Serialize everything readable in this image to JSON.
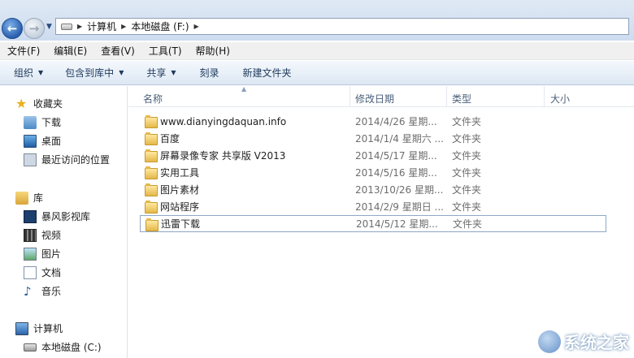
{
  "address": {
    "crumbs": [
      "计算机",
      "本地磁盘 (F:)"
    ]
  },
  "menubar": {
    "items": [
      "文件(F)",
      "编辑(E)",
      "查看(V)",
      "工具(T)",
      "帮助(H)"
    ]
  },
  "commandbar": {
    "items": [
      "组织",
      "包含到库中",
      "共享",
      "刻录",
      "新建文件夹"
    ]
  },
  "navpane": {
    "favorites": {
      "label": "收藏夹",
      "items": [
        "下载",
        "桌面",
        "最近访问的位置"
      ]
    },
    "libraries": {
      "label": "库",
      "items": [
        "暴风影视库",
        "视频",
        "图片",
        "文档",
        "音乐"
      ]
    },
    "computer": {
      "label": "计算机",
      "items": [
        "本地磁盘 (C:)"
      ]
    }
  },
  "columns": {
    "name": "名称",
    "date": "修改日期",
    "type": "类型",
    "size": "大小"
  },
  "files": [
    {
      "name": "www.dianyingdaquan.info",
      "date": "2014/4/26 星期...",
      "type": "文件夹"
    },
    {
      "name": "百度",
      "date": "2014/1/4 星期六 ...",
      "type": "文件夹"
    },
    {
      "name": "屏幕录像专家 共享版 V2013",
      "date": "2014/5/17 星期...",
      "type": "文件夹"
    },
    {
      "name": "实用工具",
      "date": "2014/5/16 星期...",
      "type": "文件夹"
    },
    {
      "name": "图片素材",
      "date": "2013/10/26 星期...",
      "type": "文件夹"
    },
    {
      "name": "网站程序",
      "date": "2014/2/9 星期日 ...",
      "type": "文件夹"
    },
    {
      "name": "迅雷下载",
      "date": "2014/5/12 星期...",
      "type": "文件夹"
    }
  ],
  "watermark": {
    "text": "系统之家"
  }
}
